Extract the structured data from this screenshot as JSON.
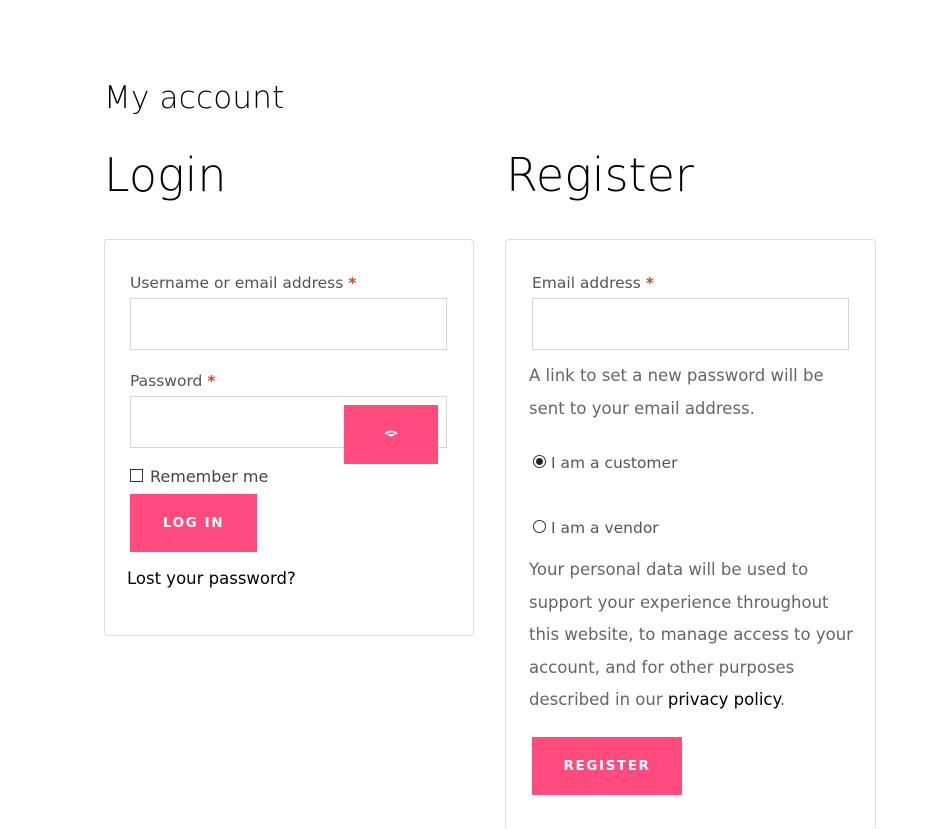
{
  "page": {
    "title": "My account"
  },
  "login": {
    "heading": "Login",
    "username_label": "Username or email address",
    "username_value": "",
    "password_label": "Password",
    "password_value": "",
    "required_mark": "*",
    "show_password_icon": "eye-icon",
    "remember_label": "Remember me",
    "remember_checked": false,
    "submit_label": "Log in",
    "lost_password_label": "Lost your password?"
  },
  "register": {
    "heading": "Register",
    "email_label": "Email address",
    "email_value": "",
    "required_mark": "*",
    "password_hint": "A link to set a new password will be sent to your email address.",
    "role_options": [
      {
        "label": "I am a customer",
        "selected": true
      },
      {
        "label": "I am a vendor",
        "selected": false
      }
    ],
    "privacy_text": "Your personal data will be used to support your experience throughout this website, to manage access to your account, and for other purposes described in our ",
    "privacy_link_label": "privacy policy",
    "privacy_text_end": ".",
    "submit_label": "Register"
  },
  "colors": {
    "accent": "#ff4b7d",
    "required": "#e2401c",
    "border": "#dddddd",
    "muted_text": "#666666"
  }
}
